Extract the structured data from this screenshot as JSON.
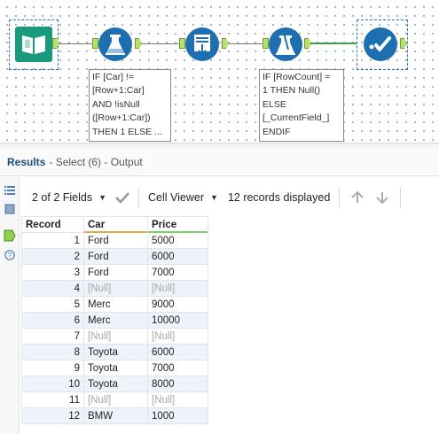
{
  "workflow": {
    "annotations": [
      "IF [Car] !=\n[Row+1:Car]\nAND !isNull\n([Row+1:Car])\nTHEN 1 ELSE ...",
      "IF [RowCount] =\n1 THEN Null()\nELSE\n[_CurrentField_]\nENDIF"
    ],
    "colors": {
      "input_tool": "#1a9a7c",
      "prep_tool": "#1d6fb0",
      "green_connection": "#3c9a4d",
      "anchor": "#b7df6c"
    }
  },
  "results": {
    "title": "Results",
    "subtitle": " - Select (6) - Output"
  },
  "toolbar": {
    "fields_label": "2 of 2 Fields",
    "viewer_label": "Cell Viewer",
    "records_label": "12 records displayed"
  },
  "grid": {
    "headers": {
      "record": "Record",
      "car": "Car",
      "price": "Price"
    },
    "rows": [
      {
        "record": "1",
        "car": "Ford",
        "price": "5000"
      },
      {
        "record": "2",
        "car": "Ford",
        "price": "6000"
      },
      {
        "record": "3",
        "car": "Ford",
        "price": "7000"
      },
      {
        "record": "4",
        "car": "[Null]",
        "price": "[Null]"
      },
      {
        "record": "5",
        "car": "Merc",
        "price": "9000"
      },
      {
        "record": "6",
        "car": "Merc",
        "price": "10000"
      },
      {
        "record": "7",
        "car": "[Null]",
        "price": "[Null]"
      },
      {
        "record": "8",
        "car": "Toyota",
        "price": "6000"
      },
      {
        "record": "9",
        "car": "Toyota",
        "price": "7000"
      },
      {
        "record": "10",
        "car": "Toyota",
        "price": "8000"
      },
      {
        "record": "11",
        "car": "[Null]",
        "price": "[Null]"
      },
      {
        "record": "12",
        "car": "BMW",
        "price": "1000"
      }
    ]
  }
}
